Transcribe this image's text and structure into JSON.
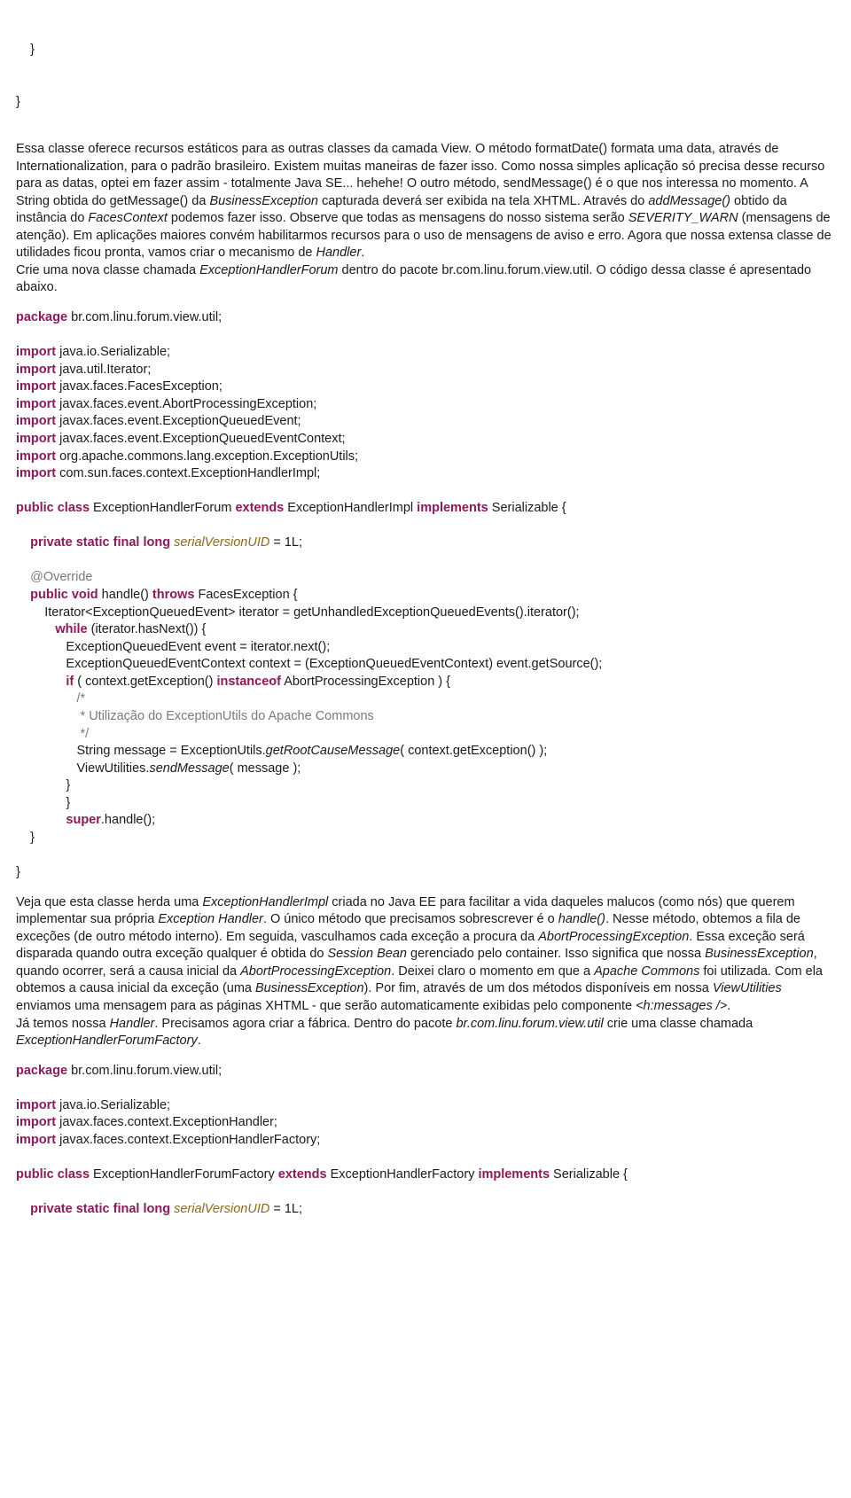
{
  "frag1_l1": "    }",
  "frag1_l2": "}",
  "para1_parts": [
    {
      "t": "Essa classe oferece recursos estáticos para as outras classes da camada View. O método formatDate() formata uma data, através de Internationalization, para o padrão brasileiro. Existem muitas maneiras de fazer isso. Como nossa simples aplicação só precisa desse recurso para as datas, optei em fazer assim - totalmente Java SE... hehehe! O outro método, sendMessage() é o que nos interessa no momento. A String obtida do getMessage() da "
    },
    {
      "t": "BusinessException",
      "i": true
    },
    {
      "t": " capturada deverá ser exibida na tela XHTML. Através do "
    },
    {
      "t": "addMessage()",
      "i": true
    },
    {
      "t": " obtido da instância do "
    },
    {
      "t": "FacesContext",
      "i": true
    },
    {
      "t": " podemos fazer isso. Observe que todas as mensagens do nosso sistema serão "
    },
    {
      "t": "SEVERITY_WARN",
      "i": true
    },
    {
      "t": " (mensagens de atenção). Em aplicações maiores convém habilitarmos recursos para o uso de mensagens de aviso e erro. Agora que nossa extensa classe de utilidades ficou pronta, vamos criar o mecanismo de "
    },
    {
      "t": "Handler",
      "i": true
    },
    {
      "t": "."
    }
  ],
  "para1b_parts": [
    {
      "t": "Crie uma nova classe chamada "
    },
    {
      "t": "ExceptionHandlerForum",
      "i": true
    },
    {
      "t": " dentro do pacote br.com.linu.forum.view.util. O código dessa classe é apresentado abaixo."
    }
  ],
  "code1": {
    "pkg_kw": "package",
    "pkg_rest": " br.com.linu.forum.view.util;",
    "imports": [
      " java.io.Serializable;",
      " java.util.Iterator;",
      " javax.faces.FacesException;",
      " javax.faces.event.AbortProcessingException;",
      " javax.faces.event.ExceptionQueuedEvent;",
      " javax.faces.event.ExceptionQueuedEventContext;",
      " org.apache.commons.lang.exception.ExceptionUtils;",
      " com.sun.faces.context.ExceptionHandlerImpl;"
    ],
    "import_kw": "import",
    "class_decl": {
      "public_class": "public class",
      "name": " ExceptionHandlerForum ",
      "extends": "extends",
      "ext_name": " ExceptionHandlerImpl ",
      "implements": "implements",
      "impl_name": " Serializable {"
    },
    "svuid": {
      "mods": "private static final long",
      "var": " serialVersionUID",
      "rest": " = 1L;"
    },
    "override": "@Override",
    "handle": {
      "mods": "public void",
      "name": " handle() ",
      "throws": "throws",
      "exc": " FacesException {"
    },
    "iter_line": "Iterator<ExceptionQueuedEvent> iterator = getUnhandledExceptionQueuedEvents().iterator();",
    "while_kw": "while",
    "while_rest": " (iterator.hasNext()) {",
    "evt_line": "ExceptionQueuedEvent event = iterator.next();",
    "ctx_line": "ExceptionQueuedEventContext context = (ExceptionQueuedEventContext) event.getSource();",
    "if_kw": "if",
    "if_mid": " ( context.getException() ",
    "instanceof": "instanceof",
    "if_rest": " AbortProcessingException ) {",
    "cmt1": "/*",
    "cmt2": " * Utilização do ExceptionUtils do Apache Commons",
    "cmt3": " */",
    "msg_a": "String message = ExceptionUtils.",
    "msg_i": "getRootCauseMessage",
    "msg_b": "( context.getException() );",
    "vu_a": "ViewUtilities.",
    "vu_i": "sendMessage",
    "vu_b": "( message );",
    "close1": "}",
    "close2": "}",
    "super_kw": "super",
    "super_rest": ".handle();",
    "close3": "}",
    "close4": "}"
  },
  "para2_parts": [
    {
      "t": "Veja que esta classe herda uma "
    },
    {
      "t": "ExceptionHandlerImpl",
      "i": true
    },
    {
      "t": " criada no Java EE para facilitar a vida daqueles malucos (como nós) que querem implementar sua própria "
    },
    {
      "t": "Exception Handler",
      "i": true
    },
    {
      "t": ". O único método que precisamos sobrescrever é o "
    },
    {
      "t": "handle()",
      "i": true
    },
    {
      "t": ". Nesse método, obtemos a fila de exceções (de outro método interno). Em seguida, vasculhamos cada exceção a procura da "
    },
    {
      "t": "AbortProcessingException",
      "i": true
    },
    {
      "t": ". Essa exceção será disparada quando outra exceção qualquer é obtida do "
    },
    {
      "t": "Session Bean",
      "i": true
    },
    {
      "t": " gerenciado pelo container. Isso significa que nossa "
    },
    {
      "t": "BusinessException",
      "i": true
    },
    {
      "t": ", quando ocorrer, será a causa inicial da "
    },
    {
      "t": "AbortProcessingException",
      "i": true
    },
    {
      "t": ". Deixei claro o momento em que a "
    },
    {
      "t": "Apache Commons",
      "i": true
    },
    {
      "t": " foi utilizada. Com ela obtemos a causa inicial da exceção (uma "
    },
    {
      "t": "BusinessException",
      "i": true
    },
    {
      "t": "). Por fim, através de um dos métodos disponíveis em nossa "
    },
    {
      "t": "ViewUtilities",
      "i": true
    },
    {
      "t": " enviamos uma mensagem para as páginas XHTML - que serão automaticamente exibidas pelo componente "
    },
    {
      "t": "<h:messages />",
      "i": true
    },
    {
      "t": "."
    }
  ],
  "para2b_parts": [
    {
      "t": "Já temos nossa "
    },
    {
      "t": "Handler",
      "i": true
    },
    {
      "t": ". Precisamos agora criar a fábrica. Dentro do pacote "
    },
    {
      "t": "br.com.linu.forum.view.util",
      "i": true
    },
    {
      "t": " crie uma classe chamada "
    },
    {
      "t": "ExceptionHandlerForumFactory",
      "i": true
    },
    {
      "t": "."
    }
  ],
  "code2": {
    "pkg_kw": "package",
    "pkg_rest": " br.com.linu.forum.view.util;",
    "imports": [
      " java.io.Serializable;",
      " javax.faces.context.ExceptionHandler;",
      " javax.faces.context.ExceptionHandlerFactory;"
    ],
    "import_kw": "import",
    "class_decl": {
      "public_class": "public class",
      "name": " ExceptionHandlerForumFactory ",
      "extends": "extends",
      "ext_name": " ExceptionHandlerFactory ",
      "implements": "implements",
      "impl_name": " Serializable {"
    },
    "svuid": {
      "mods": "private static final long",
      "var": " serialVersionUID",
      "rest": " = 1L;"
    }
  }
}
